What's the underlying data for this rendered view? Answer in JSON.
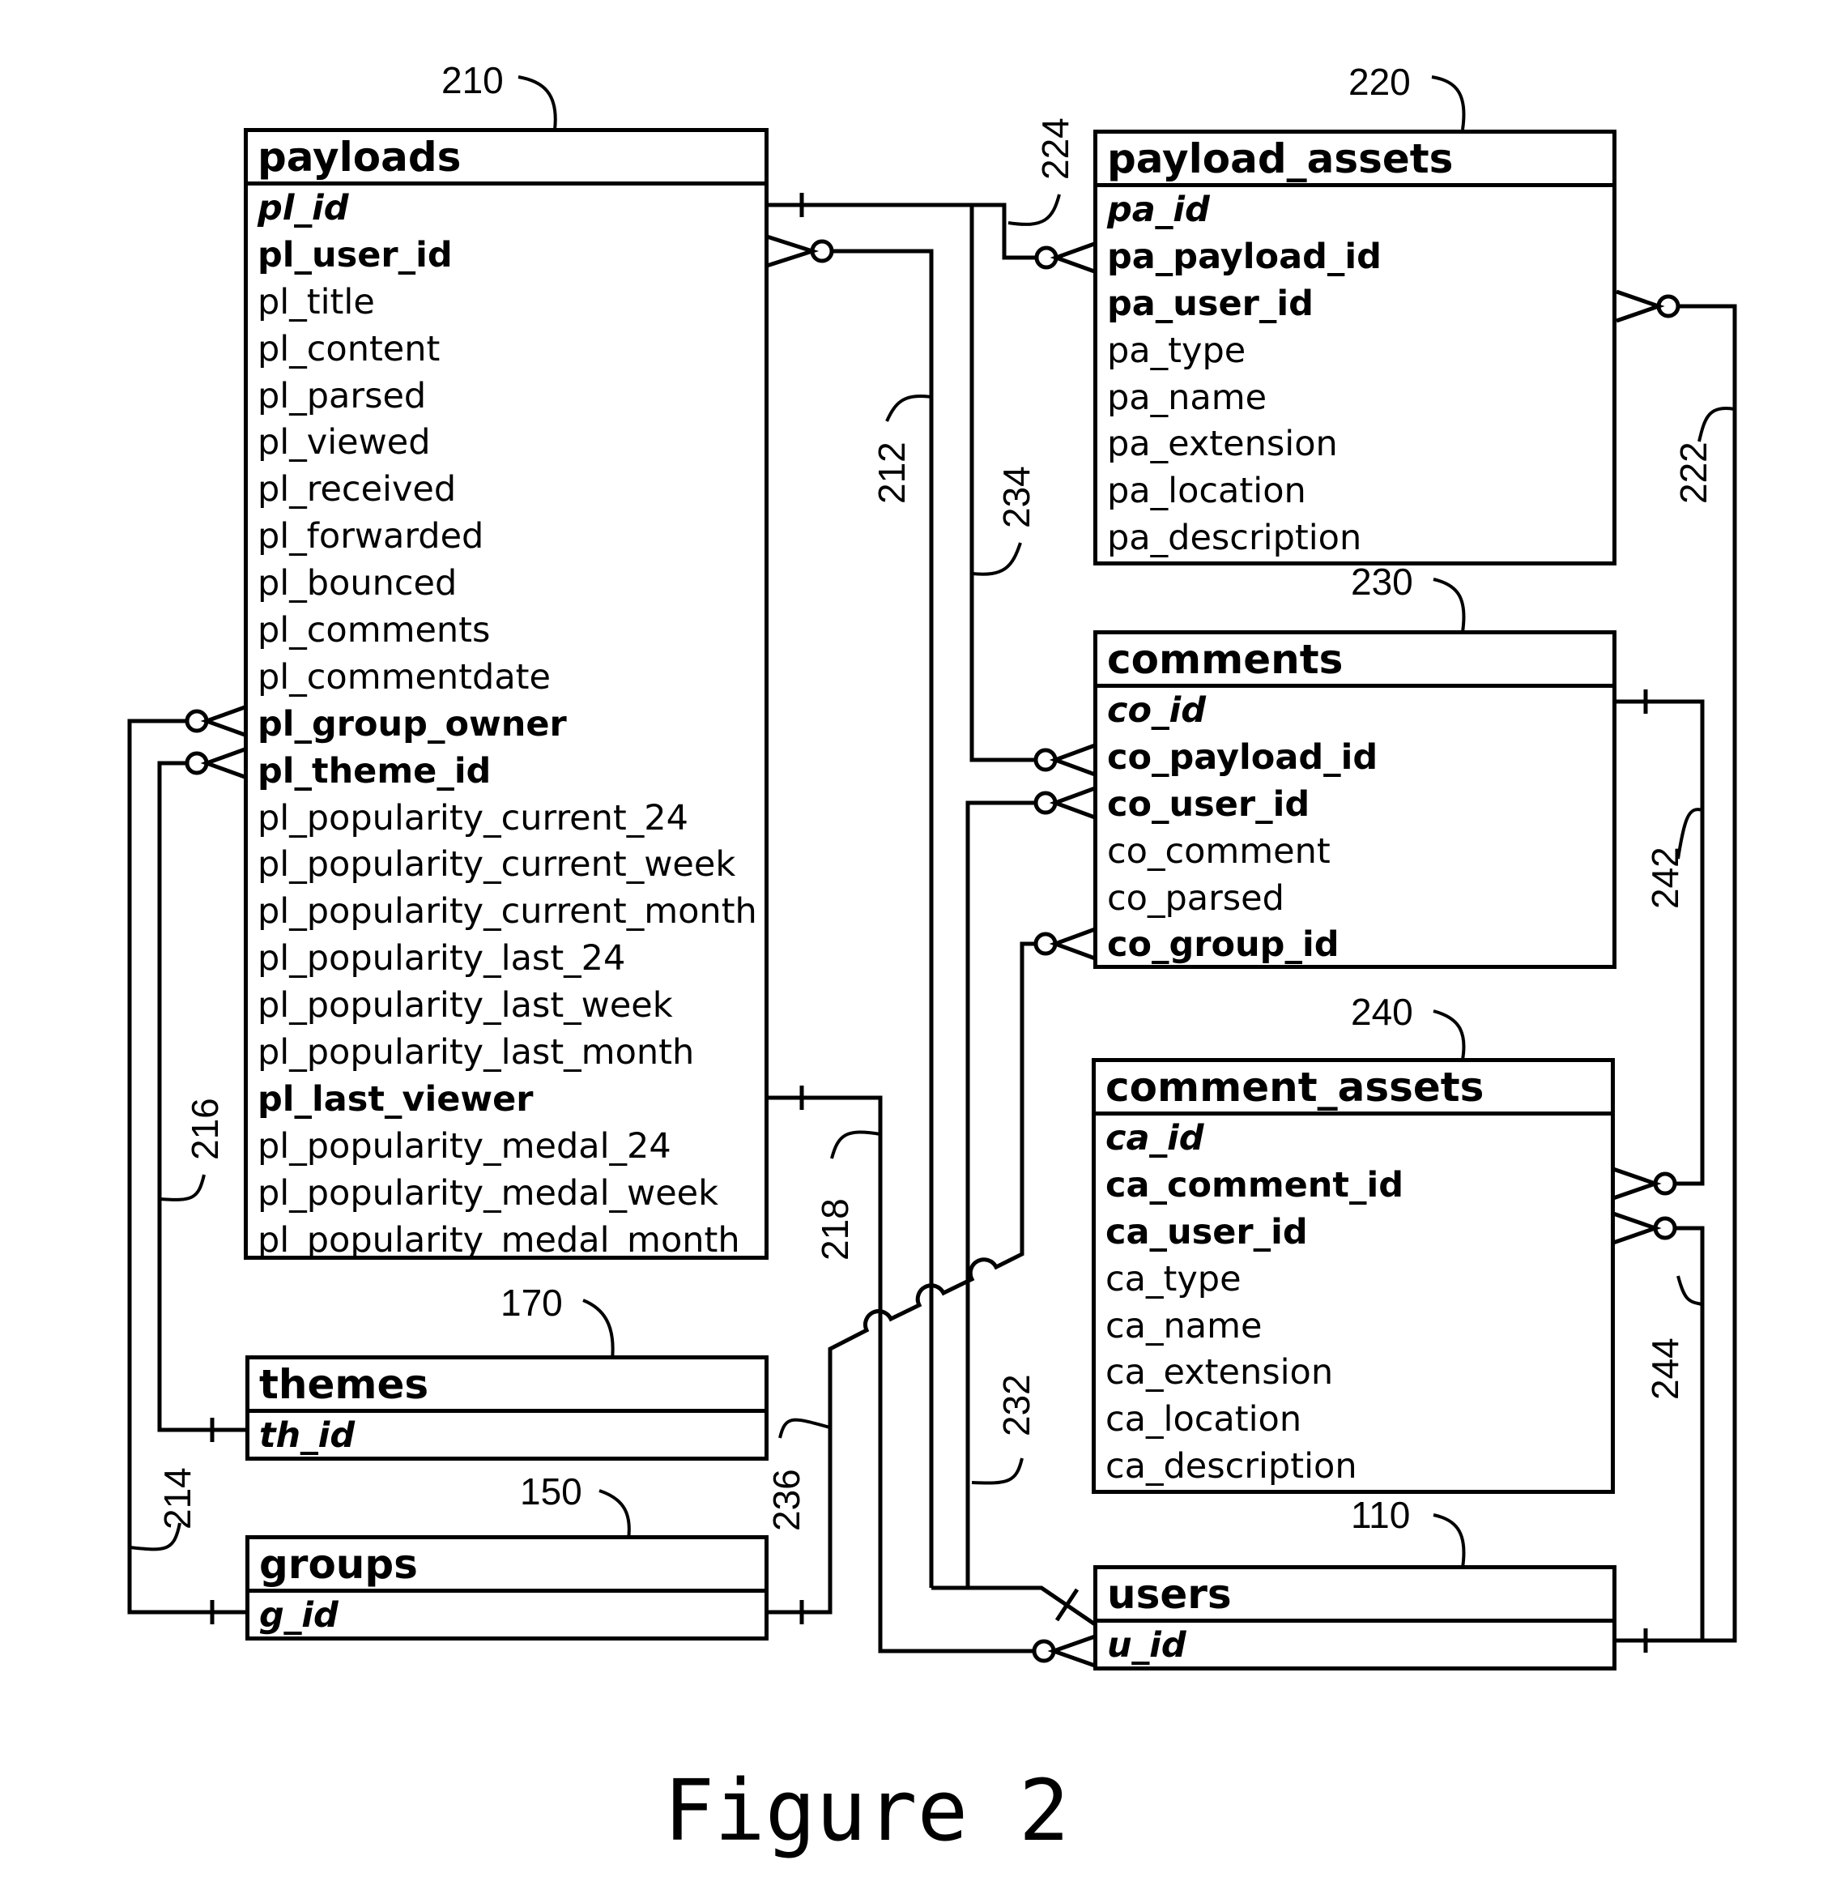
{
  "figure": {
    "caption": "Figure 2"
  },
  "tables": {
    "payloads": {
      "ref": "210",
      "name": "payloads",
      "fields": [
        {
          "name": "pl_id",
          "kind": "pk"
        },
        {
          "name": "pl_user_id",
          "kind": "fk"
        },
        {
          "name": "pl_title",
          "kind": "plain"
        },
        {
          "name": "pl_content",
          "kind": "plain"
        },
        {
          "name": "pl_parsed",
          "kind": "plain"
        },
        {
          "name": "pl_viewed",
          "kind": "plain"
        },
        {
          "name": "pl_received",
          "kind": "plain"
        },
        {
          "name": "pl_forwarded",
          "kind": "plain"
        },
        {
          "name": "pl_bounced",
          "kind": "plain"
        },
        {
          "name": "pl_comments",
          "kind": "plain"
        },
        {
          "name": "pl_commentdate",
          "kind": "plain"
        },
        {
          "name": "pl_group_owner",
          "kind": "fk"
        },
        {
          "name": "pl_theme_id",
          "kind": "fk"
        },
        {
          "name": "pl_popularity_current_24",
          "kind": "plain"
        },
        {
          "name": "pl_popularity_current_week",
          "kind": "plain"
        },
        {
          "name": "pl_popularity_current_month",
          "kind": "plain"
        },
        {
          "name": "pl_popularity_last_24",
          "kind": "plain"
        },
        {
          "name": "pl_popularity_last_week",
          "kind": "plain"
        },
        {
          "name": "pl_popularity_last_month",
          "kind": "plain"
        },
        {
          "name": "pl_last_viewer",
          "kind": "fk"
        },
        {
          "name": "pl_popularity_medal_24",
          "kind": "plain"
        },
        {
          "name": "pl_popularity_medal_week",
          "kind": "plain"
        },
        {
          "name": "pl_popularity_medal_month",
          "kind": "plain"
        }
      ]
    },
    "payload_assets": {
      "ref": "220",
      "name": "payload_assets",
      "fields": [
        {
          "name": "pa_id",
          "kind": "pk"
        },
        {
          "name": "pa_payload_id",
          "kind": "fk"
        },
        {
          "name": "pa_user_id",
          "kind": "fk"
        },
        {
          "name": "pa_type",
          "kind": "plain"
        },
        {
          "name": "pa_name",
          "kind": "plain"
        },
        {
          "name": "pa_extension",
          "kind": "plain"
        },
        {
          "name": "pa_location",
          "kind": "plain"
        },
        {
          "name": "pa_description",
          "kind": "plain"
        }
      ]
    },
    "comments": {
      "ref": "230",
      "name": "comments",
      "fields": [
        {
          "name": "co_id",
          "kind": "pk"
        },
        {
          "name": "co_payload_id",
          "kind": "fk"
        },
        {
          "name": "co_user_id",
          "kind": "fk"
        },
        {
          "name": "co_comment",
          "kind": "plain"
        },
        {
          "name": "co_parsed",
          "kind": "plain"
        },
        {
          "name": "co_group_id",
          "kind": "fk"
        }
      ]
    },
    "comment_assets": {
      "ref": "240",
      "name": "comment_assets",
      "fields": [
        {
          "name": "ca_id",
          "kind": "pk"
        },
        {
          "name": "ca_comment_id",
          "kind": "fk"
        },
        {
          "name": "ca_user_id",
          "kind": "fk"
        },
        {
          "name": "ca_type",
          "kind": "plain"
        },
        {
          "name": "ca_name",
          "kind": "plain"
        },
        {
          "name": "ca_extension",
          "kind": "plain"
        },
        {
          "name": "ca_location",
          "kind": "plain"
        },
        {
          "name": "ca_description",
          "kind": "plain"
        }
      ]
    },
    "themes": {
      "ref": "170",
      "name": "themes",
      "fields": [
        {
          "name": "th_id",
          "kind": "pk"
        }
      ]
    },
    "groups": {
      "ref": "150",
      "name": "groups",
      "fields": [
        {
          "name": "g_id",
          "kind": "pk"
        }
      ]
    },
    "users": {
      "ref": "110",
      "name": "users",
      "fields": [
        {
          "name": "u_id",
          "kind": "pk"
        }
      ]
    }
  },
  "relationships": [
    {
      "ref": "212",
      "from": "users.u_id",
      "to": "payloads.pl_user_id",
      "cardinality": "one-to-zero-or-many"
    },
    {
      "ref": "214",
      "from": "groups.g_id",
      "to": "payloads.pl_group_owner",
      "cardinality": "one-to-zero-or-many"
    },
    {
      "ref": "216",
      "from": "themes.th_id",
      "to": "payloads.pl_theme_id",
      "cardinality": "one-to-zero-or-many"
    },
    {
      "ref": "218",
      "from": "payloads.pl_last_viewer",
      "to": "users.u_id",
      "cardinality": "one-to-zero-or-many"
    },
    {
      "ref": "222",
      "from": "users.u_id",
      "to": "payload_assets.pa_user_id",
      "cardinality": "one-to-zero-or-many"
    },
    {
      "ref": "224",
      "from": "payloads.pl_id",
      "to": "payload_assets.pa_payload_id",
      "cardinality": "one-to-zero-or-many"
    },
    {
      "ref": "232",
      "from": "users.u_id",
      "to": "comments.co_user_id",
      "cardinality": "one-to-zero-or-many"
    },
    {
      "ref": "234",
      "from": "payloads.pl_id",
      "to": "comments.co_payload_id",
      "cardinality": "one-to-zero-or-many"
    },
    {
      "ref": "236",
      "from": "groups.g_id",
      "to": "comments.co_group_id",
      "cardinality": "one-to-zero-or-many"
    },
    {
      "ref": "242",
      "from": "comments.co_id",
      "to": "comment_assets.ca_comment_id",
      "cardinality": "one-to-zero-or-many"
    },
    {
      "ref": "244",
      "from": "users.u_id",
      "to": "comment_assets.ca_user_id",
      "cardinality": "one-to-zero-or-many"
    }
  ]
}
